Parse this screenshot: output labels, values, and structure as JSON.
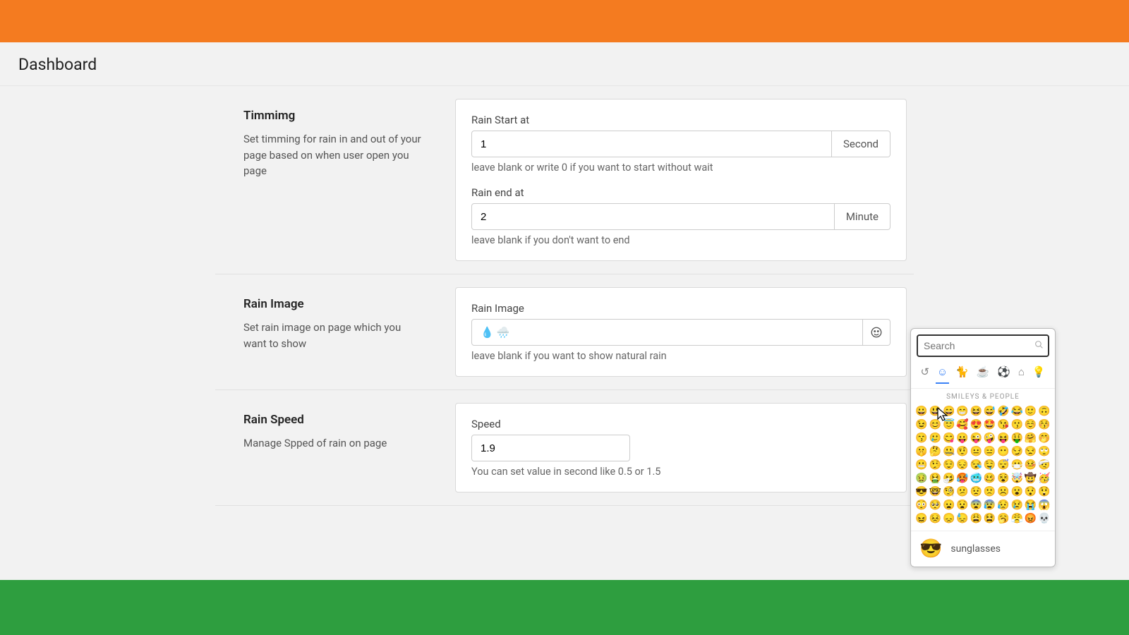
{
  "header": {
    "title": "Dashboard"
  },
  "sections": {
    "timing": {
      "title": "Timmimg",
      "desc": "Set timming for rain in and out of your page based on when user open you page",
      "start_label": "Rain Start at",
      "start_value": "1",
      "start_addon": "Second",
      "start_helper": "leave blank or write 0 if you want to start without wait",
      "end_label": "Rain end at",
      "end_value": "2",
      "end_addon": "Minute",
      "end_helper": "leave blank if you don't want to end"
    },
    "rain_image": {
      "title": "Rain Image",
      "desc": "Set rain image on page which you want to show",
      "label": "Rain Image",
      "value": "💧 🌧️",
      "helper": "leave blank if you want to show natural rain"
    },
    "rain_speed": {
      "title": "Rain Speed",
      "desc": "Manage Spped of rain on page",
      "label": "Speed",
      "value": "1.9",
      "helper": "You can set value in second like 0.5 or 1.5"
    }
  },
  "emoji_picker": {
    "search_placeholder": "Search",
    "section_label": "SMILEYS & PEOPLE",
    "preview_glyph": "😎",
    "preview_name": "sunglasses",
    "categories": [
      "↺",
      "☺",
      "🐈",
      "☕",
      "⚽",
      "⌂",
      "💡"
    ],
    "grid": [
      "😀",
      "😃",
      "😄",
      "😁",
      "😆",
      "😅",
      "🤣",
      "😂",
      "🙂",
      "🙃",
      "😉",
      "😊",
      "😇",
      "🥰",
      "😍",
      "🤩",
      "😘",
      "😗",
      "☺️",
      "😚",
      "😙",
      "🥲",
      "😋",
      "😛",
      "😜",
      "🤪",
      "😝",
      "🤑",
      "🤗",
      "🤭",
      "🤫",
      "🤔",
      "🤐",
      "🤨",
      "😐",
      "😑",
      "😶",
      "😏",
      "😒",
      "🙄",
      "😬",
      "🤥",
      "😌",
      "😔",
      "😪",
      "🤤",
      "😴",
      "😷",
      "🤒",
      "🤕",
      "🤢",
      "🤮",
      "🤧",
      "🥵",
      "🥶",
      "🥴",
      "😵",
      "🤯",
      "🤠",
      "🥳",
      "😎",
      "🤓",
      "🧐",
      "😕",
      "😟",
      "🙁",
      "☹️",
      "😮",
      "😯",
      "😲",
      "😳",
      "🥺",
      "😦",
      "😧",
      "😨",
      "😰",
      "😥",
      "😢",
      "😭",
      "😱",
      "😖",
      "😣",
      "😞",
      "😓",
      "😩",
      "😫",
      "🥱",
      "😤",
      "😡",
      "💀"
    ]
  }
}
